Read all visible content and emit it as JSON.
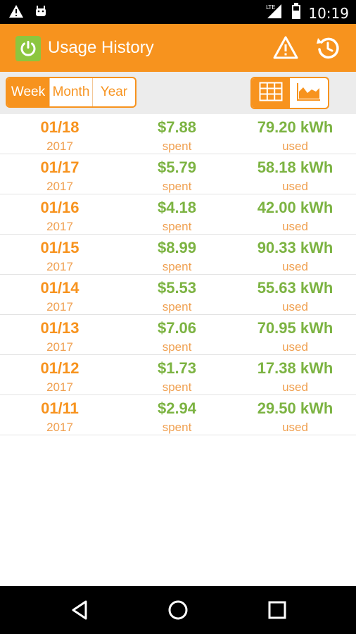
{
  "status_bar": {
    "time": "10:19",
    "network": "LTE",
    "icons": [
      "warning-icon",
      "android-icon",
      "signal-icon",
      "battery-icon"
    ]
  },
  "app_bar": {
    "title": "Usage History",
    "icons": [
      "power-icon",
      "warning-icon",
      "refresh-icon"
    ]
  },
  "period_tabs": [
    {
      "label": "Week",
      "active": true
    },
    {
      "label": "Month",
      "active": false
    },
    {
      "label": "Year",
      "active": false
    }
  ],
  "view_toggle": [
    {
      "icon": "table-icon",
      "active": true
    },
    {
      "icon": "area-chart-icon",
      "active": false
    }
  ],
  "colors": {
    "accent": "#f7931e",
    "green": "#7cb342",
    "logo_green": "#8cc63f"
  },
  "rows": [
    {
      "date": "01/18",
      "year": "2017",
      "cost": "$7.88",
      "spent": "spent",
      "kwh": "79.20 kWh",
      "used": "used"
    },
    {
      "date": "01/17",
      "year": "2017",
      "cost": "$5.79",
      "spent": "spent",
      "kwh": "58.18 kWh",
      "used": "used"
    },
    {
      "date": "01/16",
      "year": "2017",
      "cost": "$4.18",
      "spent": "spent",
      "kwh": "42.00 kWh",
      "used": "used"
    },
    {
      "date": "01/15",
      "year": "2017",
      "cost": "$8.99",
      "spent": "spent",
      "kwh": "90.33 kWh",
      "used": "used"
    },
    {
      "date": "01/14",
      "year": "2017",
      "cost": "$5.53",
      "spent": "spent",
      "kwh": "55.63 kWh",
      "used": "used"
    },
    {
      "date": "01/13",
      "year": "2017",
      "cost": "$7.06",
      "spent": "spent",
      "kwh": "70.95 kWh",
      "used": "used"
    },
    {
      "date": "01/12",
      "year": "2017",
      "cost": "$1.73",
      "spent": "spent",
      "kwh": "17.38 kWh",
      "used": "used"
    },
    {
      "date": "01/11",
      "year": "2017",
      "cost": "$2.94",
      "spent": "spent",
      "kwh": "29.50 kWh",
      "used": "used"
    }
  ],
  "nav_bar": {
    "icons": [
      "back-icon",
      "home-icon",
      "recents-icon"
    ]
  }
}
